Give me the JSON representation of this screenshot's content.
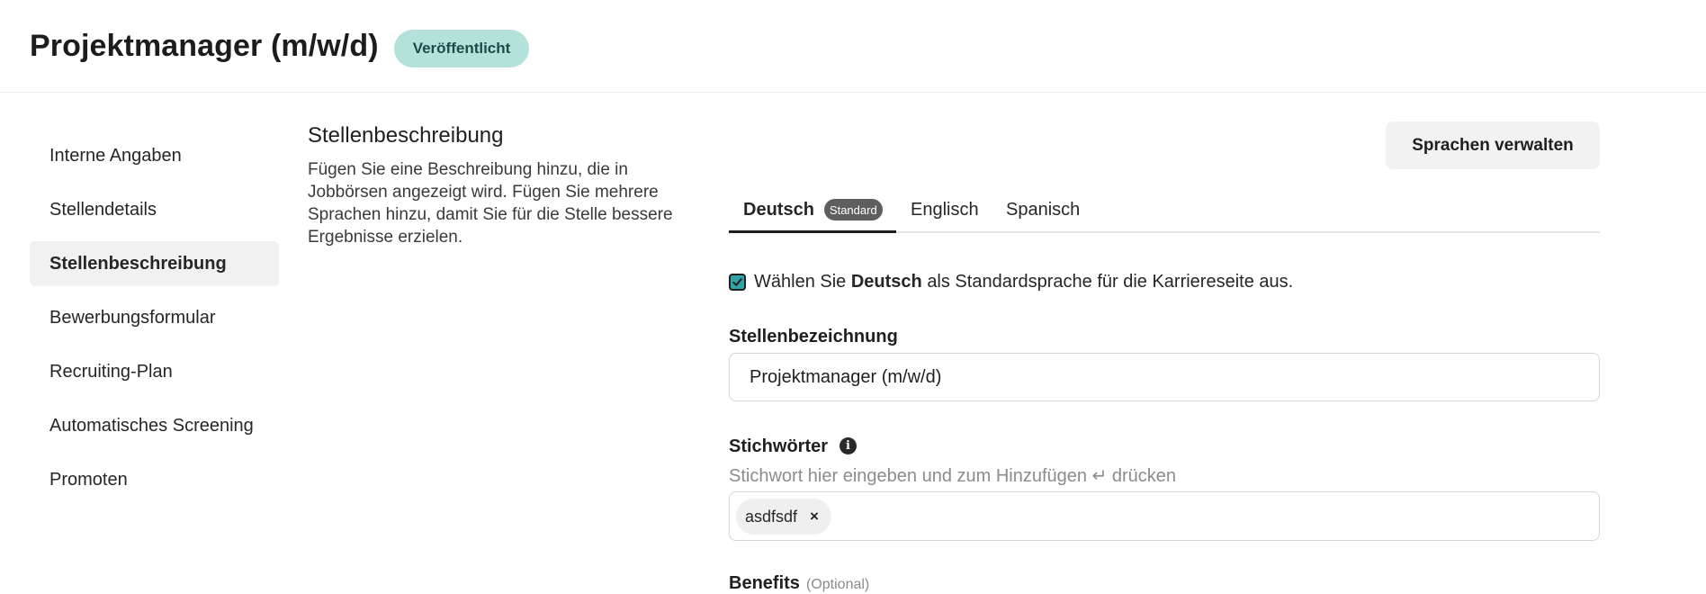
{
  "header": {
    "title": "Projektmanager (m/w/d)",
    "status": "Veröffentlicht"
  },
  "sidebar": {
    "items": [
      {
        "label": "Interne Angaben"
      },
      {
        "label": "Stellendetails"
      },
      {
        "label": "Stellenbeschreibung",
        "active": true
      },
      {
        "label": "Bewerbungsformular"
      },
      {
        "label": "Recruiting-Plan"
      },
      {
        "label": "Automatisches Screening"
      },
      {
        "label": "Promoten"
      }
    ]
  },
  "section": {
    "title": "Stellenbeschreibung",
    "description": "Fügen Sie eine Beschreibung hinzu, die in Jobbörsen angezeigt wird. Fügen Sie mehrere Sprachen hinzu, damit Sie für die Stelle bessere Ergebnisse erzielen.",
    "manage_languages_label": "Sprachen verwalten"
  },
  "tabs": [
    {
      "label": "Deutsch",
      "badge": "Standard",
      "active": true
    },
    {
      "label": "Englisch"
    },
    {
      "label": "Spanisch"
    }
  ],
  "default_language": {
    "checked": true,
    "prefix": "Wählen Sie",
    "language": "Deutsch",
    "suffix": "als Standardsprache für die Karriereseite aus."
  },
  "job_title_field": {
    "label": "Stellenbezeichnung",
    "value": "Projektmanager (m/w/d)"
  },
  "keywords_field": {
    "label": "Stichwörter",
    "info_icon": "info-icon",
    "hint": "Stichwort hier eingeben und zum Hinzufügen ↵ drücken",
    "tags": [
      {
        "label": "asdfsdf",
        "remove": "×"
      }
    ]
  },
  "benefits_field": {
    "label": "Benefits",
    "optional": "(Optional)"
  },
  "colors": {
    "status_badge_bg": "#b5e1db",
    "checkbox_fill": "#2fa3a6",
    "active_nav_bg": "#f1f1f1"
  }
}
